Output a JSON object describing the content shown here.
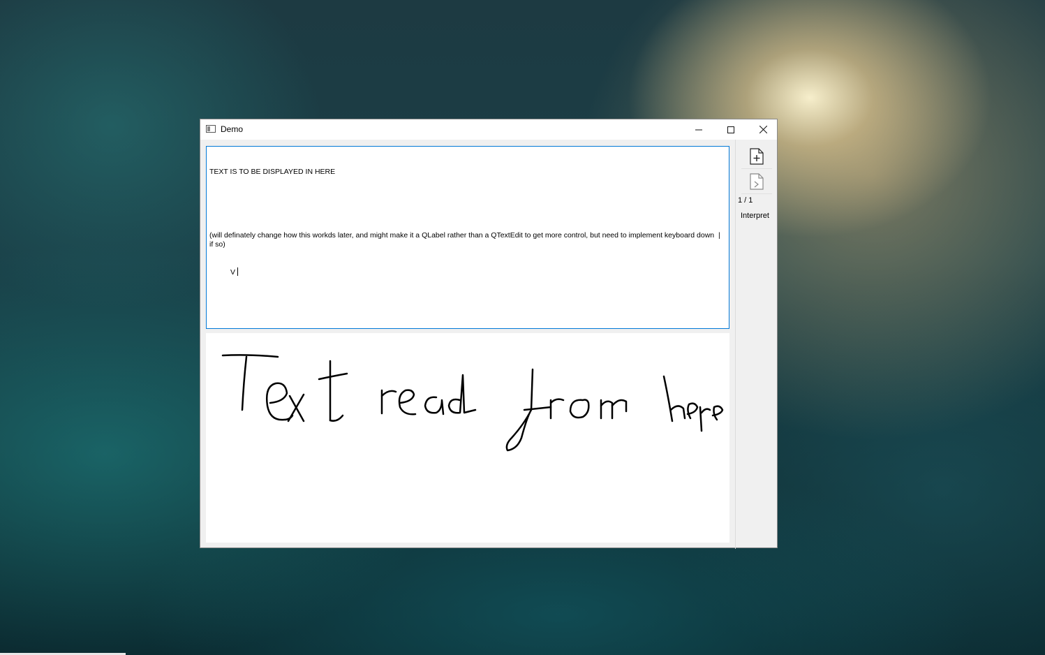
{
  "window": {
    "title": "Demo",
    "controls": {
      "minimize_icon": "minimize-icon",
      "maximize_icon": "maximize-icon",
      "close_icon": "close-icon"
    }
  },
  "editor": {
    "line1": "TEXT IS TO BE DISPLAYED IN HERE",
    "line2": "(will definately change how this workds later, and might make it a QLabel rather than a QTextEdit to get more control, but need to implement keyboard down  |  if so)",
    "line3": "V"
  },
  "canvas": {
    "handwriting": "Text read from here",
    "stroke_color": "#000000"
  },
  "sidebar": {
    "new_page_icon": "add-page-icon",
    "next_page_icon": "page-icon",
    "page_counter": "1 / 1",
    "interpret_label": "Interpret"
  },
  "colors": {
    "editor_focus_border": "#0078d7",
    "window_background": "#f0f0f0"
  }
}
